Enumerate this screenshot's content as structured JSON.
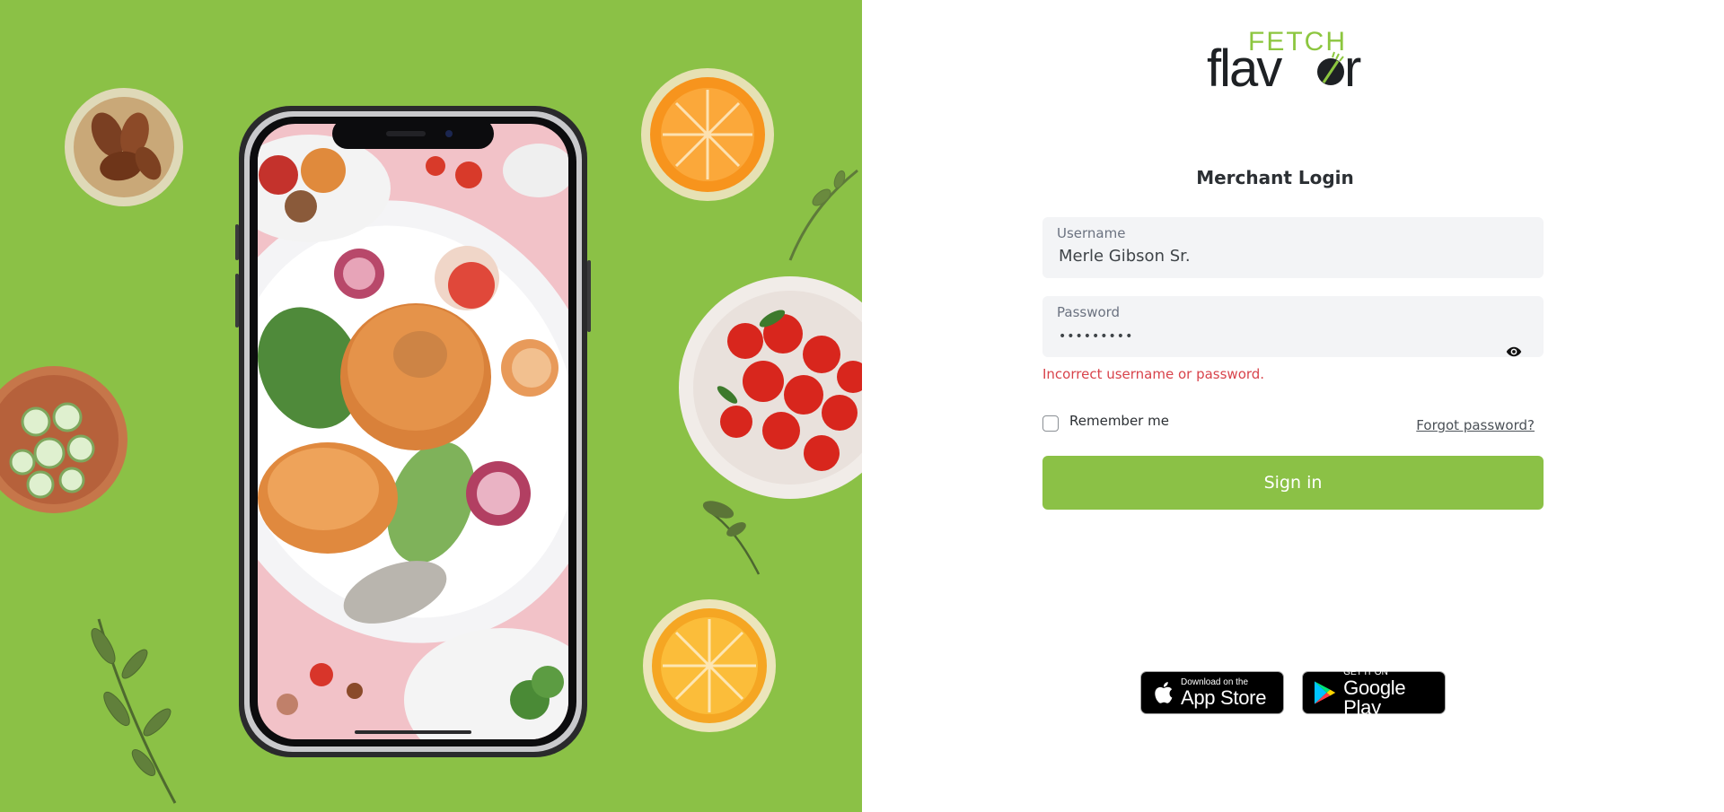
{
  "brand": {
    "logo_top": "FETCH",
    "logo_bottom": "flavor",
    "colors": {
      "primary_green": "#8bc146",
      "logo_green": "#8cc63f",
      "dark": "#1e2124",
      "error": "#d8434b"
    }
  },
  "form": {
    "title": "Merchant Login",
    "username": {
      "label": "Username",
      "value": "Merle Gibson Sr."
    },
    "password": {
      "label": "Password",
      "value": "•••••••••",
      "toggle_icon": "eye-icon"
    },
    "error_message": "Incorrect username or password.",
    "remember_me_label": "Remember me",
    "remember_me_checked": false,
    "forgot_password_label": "Forgot password?",
    "submit_label": "Sign in"
  },
  "stores": {
    "apple": {
      "small": "Download on the",
      "big": "App Store",
      "icon": "apple-icon"
    },
    "google": {
      "small": "GET IT ON",
      "big": "Google Play",
      "icon": "google-play-icon"
    }
  }
}
